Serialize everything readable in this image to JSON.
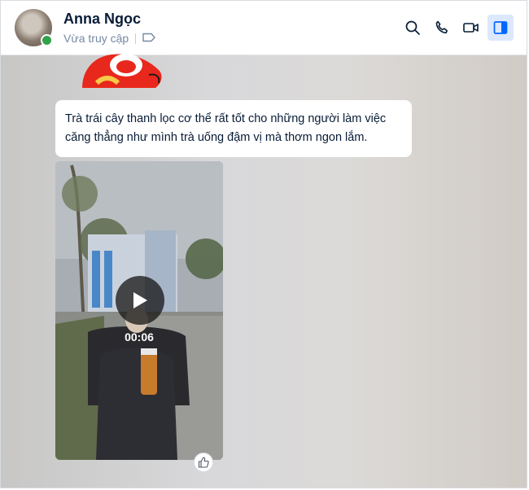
{
  "contact": {
    "name": "Anna Ngọc",
    "status": "Vừa truy cập",
    "online": true
  },
  "header_actions": [
    {
      "icon": "search-icon"
    },
    {
      "icon": "phone-icon"
    },
    {
      "icon": "video-call-icon"
    },
    {
      "icon": "sidebar-toggle-icon",
      "active": true
    }
  ],
  "messages": {
    "text": "Trà trái cây thanh lọc cơ thể rất tốt cho những người làm việc căng thẳng như mình trà uống đậm vị mà thơm ngon lắm.",
    "video": {
      "duration": "00:06"
    }
  },
  "colors": {
    "accent": "#0068ff",
    "online": "#30a24c",
    "name_text": "#081c36",
    "status_text": "#7589a3"
  }
}
